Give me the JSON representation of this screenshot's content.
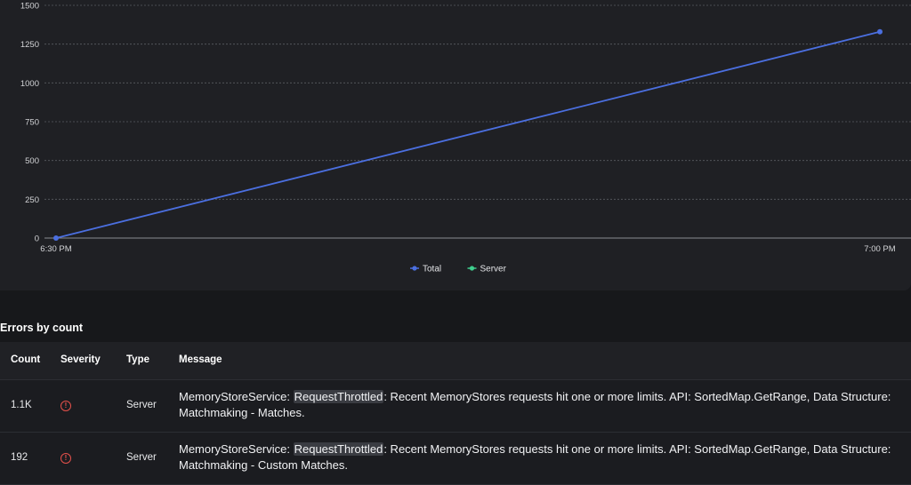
{
  "chart_data": {
    "type": "line",
    "x": [
      "6:30 PM",
      "7:00 PM"
    ],
    "series": [
      {
        "name": "Total",
        "values": [
          0,
          1330
        ],
        "color": "#4b6fe0"
      },
      {
        "name": "Server",
        "values": [],
        "color": "#3fcf8e"
      }
    ],
    "yticks": [
      0,
      250,
      500,
      750,
      1000,
      1250,
      1500
    ],
    "ylim": [
      0,
      1500
    ],
    "grid": true,
    "legend_position": "bottom-center"
  },
  "errors": {
    "title": "Errors by count",
    "columns": [
      "Count",
      "Severity",
      "Type",
      "Message"
    ],
    "rows": [
      {
        "count": "1.1K",
        "severity_icon": "error-circle-icon",
        "type": "Server",
        "msg_prefix": "MemoryStoreService: ",
        "msg_highlight": "RequestThrottled",
        "msg_suffix": ": Recent MemoryStores requests hit one or more limits. API: SortedMap.GetRange, Data Structure: Matchmaking - Matches."
      },
      {
        "count": "192",
        "severity_icon": "error-circle-icon",
        "type": "Server",
        "msg_prefix": "MemoryStoreService: ",
        "msg_highlight": "RequestThrottled",
        "msg_suffix": ": Recent MemoryStores requests hit one or more limits. API: SortedMap.GetRange, Data Structure: Matchmaking - Custom Matches."
      }
    ]
  },
  "colors": {
    "severity_error": "#e5514b",
    "accent": "#4b6fe0"
  }
}
